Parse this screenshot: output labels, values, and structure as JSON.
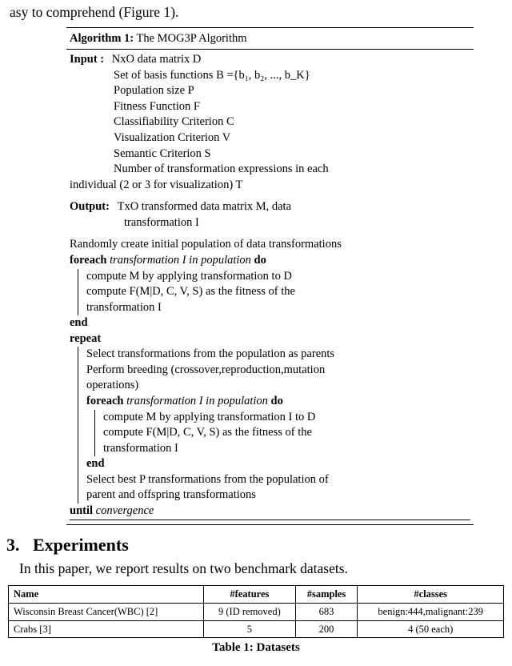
{
  "top_fragment": "asy to comprehend (Figure 1).",
  "algorithm": {
    "caption_label": "Algorithm 1:",
    "caption_text": " The MOG3P Algorithm",
    "input_label": "Input  :",
    "inputs": {
      "l1": "NxO data matrix D",
      "l2": "Set of basis functions B ={b₁, b₂, ..., b_K}",
      "l3": "Population size P",
      "l4": "Fitness Function F",
      "l5": "Classifiability Criterion C",
      "l6": "Visualization Criterion V",
      "l7": "Semantic Criterion S",
      "l8": "Number of transformation expressions in each",
      "l8b": "individual (2 or 3 for visualization) T"
    },
    "output_label": "Output:",
    "output_l1": "TxO transformed data matrix M, data",
    "output_l2": "transformation I",
    "init": "Randomly create initial population of data transformations",
    "foreach_kw": "foreach ",
    "foreach_cond": "transformation I in population ",
    "do_kw": "do",
    "foreach_body1": "compute M by applying transformation to D",
    "foreach_body2a": "compute F(M|D, C, V, S) as the fitness of the",
    "foreach_body2b": "transformation I",
    "end_kw": "end",
    "repeat_kw": "repeat",
    "rep1": "Select transformations from the population as parents",
    "rep2a": "Perform breeding (crossover,reproduction,mutation",
    "rep2b": "operations)",
    "foreach2_body1": "compute M by applying transformation I to D",
    "foreach2_body2a": "compute F(M|D, C, V, S) as the fitness of the",
    "foreach2_body2b": "transformation I",
    "rep3a": "Select best P transformations from the population of",
    "rep3b": "parent and offspring transformations",
    "until_kw": "until ",
    "until_cond": "convergence"
  },
  "section": {
    "number": "3.",
    "title": "Experiments"
  },
  "body": "In this paper, we report results on two benchmark datasets.",
  "table": {
    "headers": {
      "c1": "Name",
      "c2": "#features",
      "c3": "#samples",
      "c4": "#classes"
    },
    "rows": [
      {
        "c1": "Wisconsin Breast Cancer(WBC) [2]",
        "c2": "9 (ID removed)",
        "c3": "683",
        "c4": "benign:444,malignant:239"
      },
      {
        "c1": "Crabs [3]",
        "c2": "5",
        "c3": "200",
        "c4": "4 (50 each)"
      }
    ],
    "caption": "Table 1: Datasets"
  }
}
